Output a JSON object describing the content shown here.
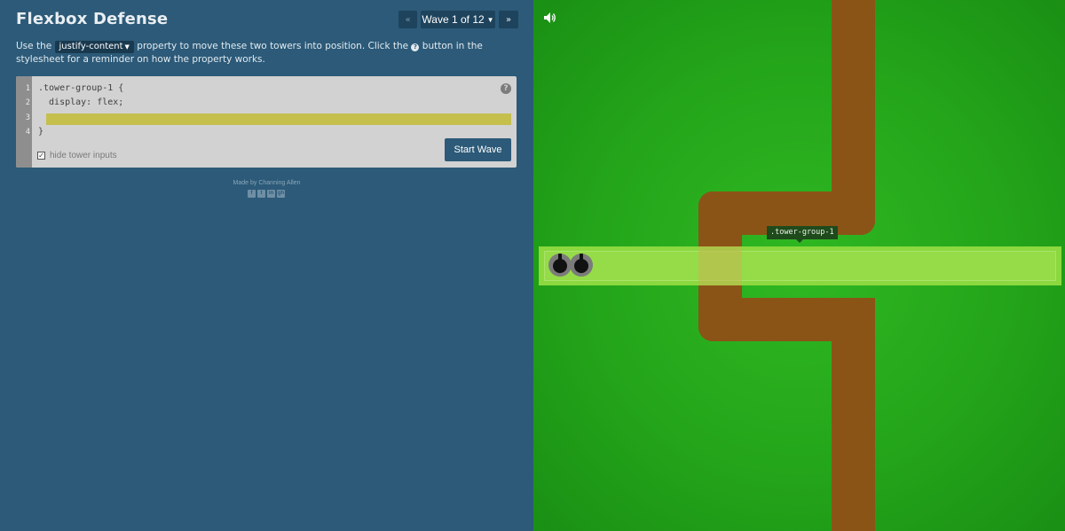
{
  "app": {
    "title": "Flexbox Defense"
  },
  "wave_nav": {
    "prev_icon": "«",
    "wave_label": "Wave 1 of 12",
    "next_icon": "»"
  },
  "instructions": {
    "before": "Use the ",
    "property": "justify-content",
    "after_property": " property to move these two towers into position. Click the ",
    "help_glyph": "?",
    "after_help": " button in the stylesheet for a reminder on how the property works."
  },
  "editor": {
    "line_numbers": [
      "1",
      "2",
      "3",
      "4"
    ],
    "line1": ".tower-group-1 {",
    "line2": "  display: flex;",
    "line4": "}",
    "input_value": "",
    "help_glyph": "?",
    "start_wave_label": "Start Wave",
    "hide_inputs_label": "hide tower inputs",
    "hide_inputs_checked": true
  },
  "footer": {
    "credit": "Made by Channing Allen",
    "social_icons": [
      "facebook-icon",
      "twitter-icon",
      "linkedin-icon",
      "github-icon"
    ],
    "social_glyphs": [
      "f",
      "t",
      "in",
      "gh"
    ]
  },
  "board": {
    "tower_group_label": ".tower-group-1",
    "tower_count": 2,
    "colors": {
      "grass": "#24a51a",
      "path": "#8b5417",
      "tower_group": "#8bd83f",
      "panel": "#2c5a78"
    }
  }
}
